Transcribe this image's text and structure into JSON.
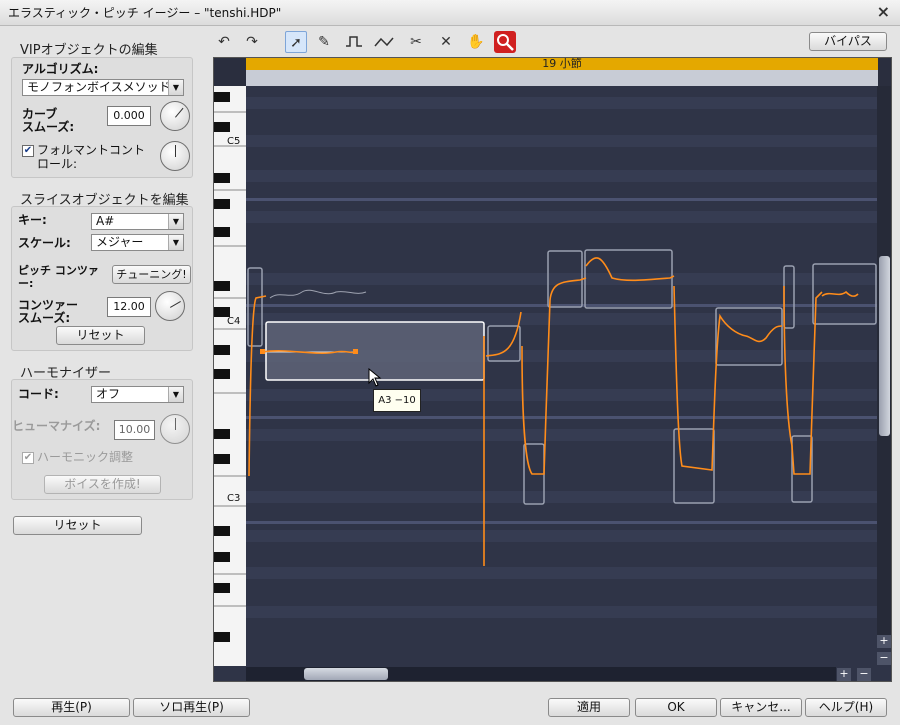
{
  "window": {
    "title": "エラスティック・ピッチ イージー – \"tenshi.HDP\"",
    "close_glyph": "×"
  },
  "vip": {
    "heading": "VIPオブジェクトの編集",
    "algorithm_label": "アルゴリズム:",
    "algorithm_value": "モノフォンボイスメソッド",
    "curve_smooth_label": "カーブ\nスムーズ:",
    "curve_smooth_value": "0.000",
    "formant_label": "フォルマントコントロール:"
  },
  "slice": {
    "heading": "スライスオブジェクトを編集",
    "key_label": "キー:",
    "key_value": "A#",
    "scale_label": "スケール:",
    "scale_value": "メジャー",
    "pitch_contour_label": "ピッチ コンツァー:",
    "tuning_button": "チューニング!",
    "contour_smooth_label": "コンツァー\nスムーズ:",
    "contour_smooth_value": "12.00",
    "reset_button": "リセット"
  },
  "harmonizer": {
    "heading": "ハーモナイザー",
    "chord_label": "コード:",
    "chord_value": "オフ",
    "humanize_label": "ヒューマナイズ:",
    "humanize_value": "10.00",
    "harmonic_adjust_label": "ハーモニック調整",
    "create_voice_button": "ボイスを作成!"
  },
  "reset_all_button": "リセット",
  "toolbar": {
    "bypass_button": "バイパス",
    "tools": [
      "undo-icon",
      "redo-icon",
      "pointer-icon",
      "pencil-icon",
      "pulse-icon",
      "curve-icon",
      "scissors-icon",
      "erase-icon",
      "hand-icon",
      "zoom-icon"
    ]
  },
  "editor": {
    "measure_label": "19 小節",
    "key_labels": [
      "C5",
      "C4",
      "C3"
    ],
    "tooltip": "A3 −10",
    "zoom_plus": "+",
    "zoom_minus": "−",
    "colors": {
      "background": "#2f3447",
      "pitch_curve": "#ff8c1a",
      "ruler": "#e4a800",
      "selection_border": "#ffffff"
    }
  },
  "footer": {
    "play_button": "再生(P)",
    "solo_play_button": "ソロ再生(P)",
    "apply_button": "適用",
    "ok_button": "OK",
    "cancel_button": "キャンセ...",
    "help_button": "ヘルプ(H)"
  }
}
